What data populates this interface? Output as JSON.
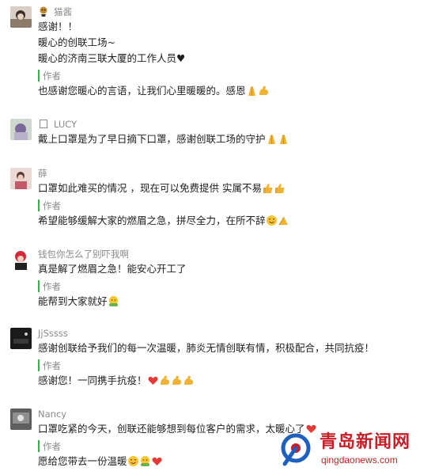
{
  "comments": [
    {
      "name": "猫酱",
      "lines": [
        "感谢！！",
        "暖心的创联工场~",
        "暖心的济南三联大厦的工作人员♥"
      ],
      "author_label": "作者",
      "reply": "也感谢您暖心的言语，让我们心里暖暖的。感恩",
      "reply_emojis": [
        "pray-emoji",
        "muscle-emoji"
      ]
    },
    {
      "name": "LUCY",
      "lines": [
        "戴上口罩是为了早日摘下口罩，感谢创联工场的守护"
      ],
      "line_emojis": [
        "pray-emoji",
        "pray-emoji"
      ]
    },
    {
      "name": "薛",
      "lines": [
        "口罩如此难买的情况 ，现在可以免费提供 实属不易"
      ],
      "line_emojis": [
        "thumbs-up-emoji",
        "thumbs-up-emoji"
      ],
      "author_label": "作者",
      "reply": "希望能够缓解大家的燃眉之急，拼尽全力，在所不辞",
      "reply_emojis": [
        "smile-emoji",
        "pray-emoji"
      ]
    },
    {
      "name": "钱包你怎么了别吓我啊",
      "lines": [
        "真是解了燃眉之急！能安心开工了"
      ],
      "author_label": "作者",
      "reply": "能帮到大家就好",
      "reply_emojis": [
        "hug-emoji"
      ]
    },
    {
      "name": "JjSssss",
      "lines": [
        "感谢创联给予我们的每一次温暖，肺炎无情创联有情，积极配合，共同抗疫！"
      ],
      "author_label": "作者",
      "reply": "感谢您！一同携手抗疫！",
      "reply_emojis": [
        "heart-emoji",
        "muscle-emoji",
        "muscle-emoji",
        "muscle-emoji"
      ]
    },
    {
      "name": "Nancy",
      "lines": [
        "口罩吃紧的今天，创联还能够想到每位客户的需求，太暖心了"
      ],
      "line_emojis": [
        "heart-emoji"
      ],
      "author_label": "作者",
      "reply": "愿给您带去一份温暖",
      "reply_emojis": [
        "smile-emoji",
        "hug-emoji",
        "heart-emoji"
      ]
    }
  ],
  "watermark": {
    "title": "青岛新闻网",
    "url": "qingdaonews.com"
  },
  "colors": {
    "author_bar": "#33b34a",
    "name_gray": "#8a8a8a",
    "watermark_red": "#c81e27"
  }
}
